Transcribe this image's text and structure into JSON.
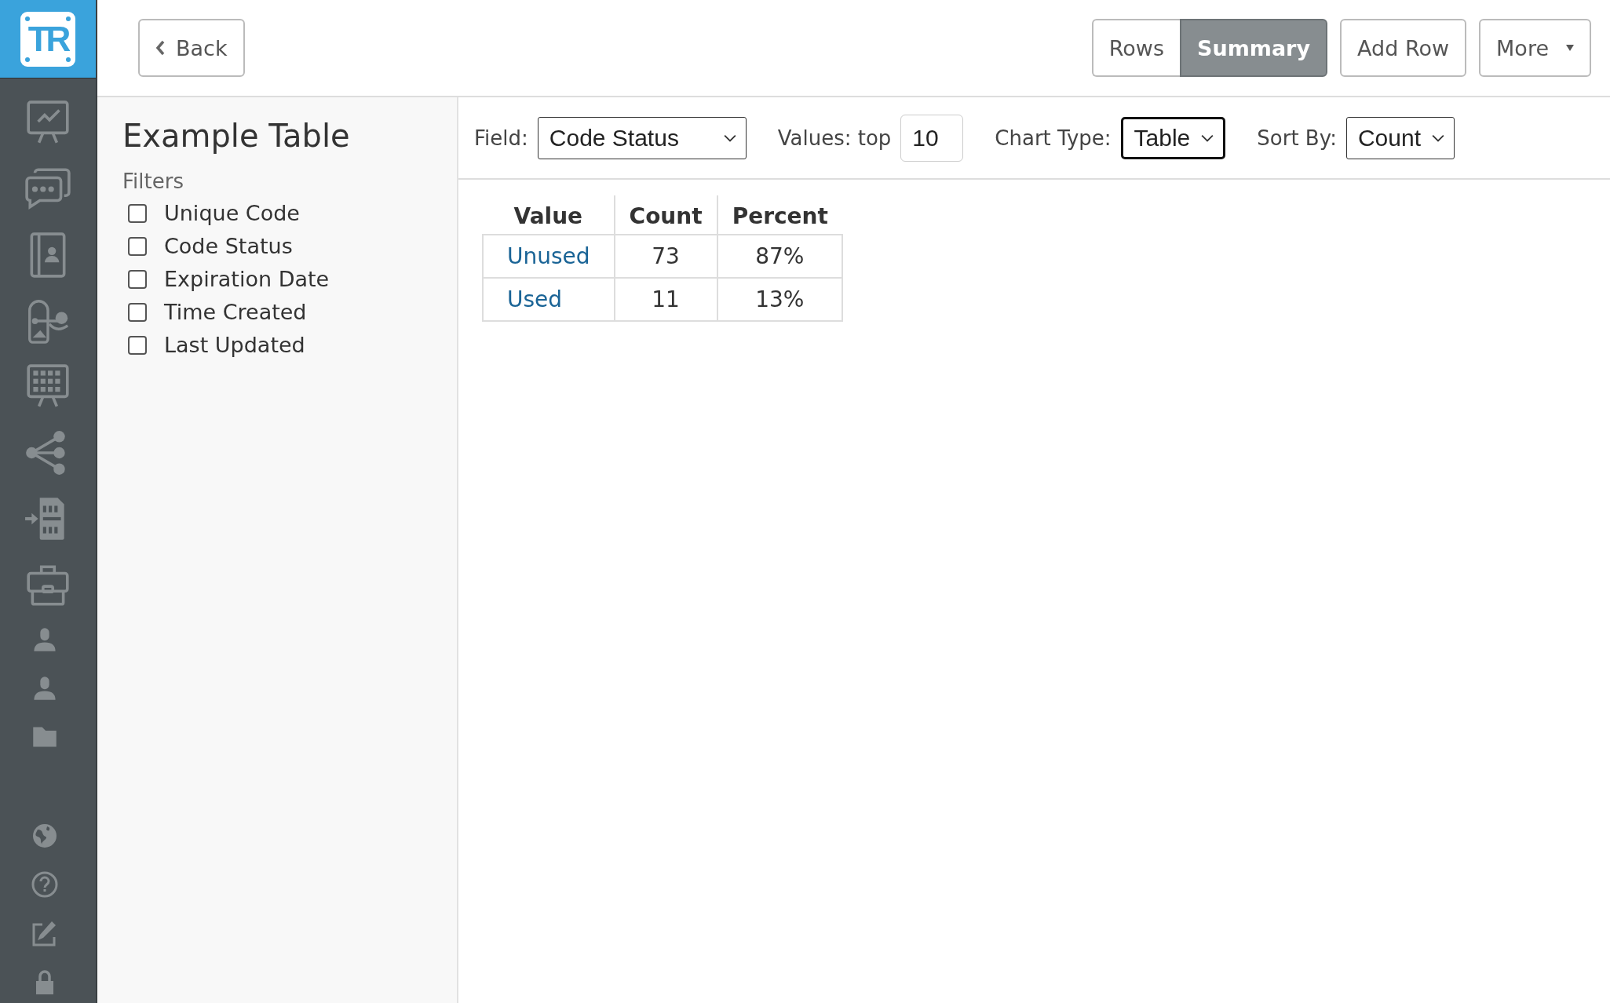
{
  "logo": {
    "text": "TR"
  },
  "back_button": {
    "label": "Back"
  },
  "view_toggle": [
    {
      "label": "Rows",
      "selected": false
    },
    {
      "label": "Summary",
      "selected": true
    }
  ],
  "actions": [
    {
      "label": "Add Row",
      "kind": "plain"
    },
    {
      "label": "More",
      "kind": "dropdown"
    }
  ],
  "panel": {
    "title": "Example Table",
    "filters_heading": "Filters",
    "filters": [
      {
        "label": "Unique Code",
        "checked": false
      },
      {
        "label": "Code Status",
        "checked": false
      },
      {
        "label": "Expiration Date",
        "checked": false
      },
      {
        "label": "Time Created",
        "checked": false
      },
      {
        "label": "Last Updated",
        "checked": false
      }
    ]
  },
  "controls": [
    {
      "kind": "select",
      "label": "Field:",
      "value": "Code Status",
      "focused": false
    },
    {
      "kind": "input",
      "label": "Values: top",
      "value": "10",
      "focused": false
    },
    {
      "kind": "select",
      "label": "Chart Type:",
      "value": "Table",
      "focused": true
    },
    {
      "kind": "select",
      "label": "Sort By:",
      "value": "Count",
      "focused": false
    }
  ],
  "table": {
    "columns": [
      "Value",
      "Count",
      "Percent"
    ],
    "rows": [
      [
        "Unused",
        "73",
        "87%"
      ],
      [
        "Used",
        "11",
        "13%"
      ]
    ]
  }
}
